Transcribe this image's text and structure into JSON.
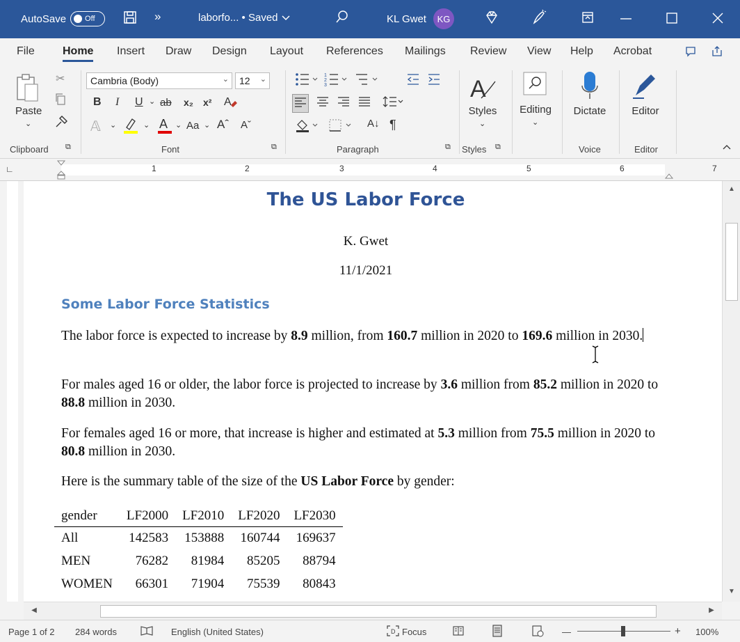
{
  "titlebar": {
    "autosave_label": "AutoSave",
    "autosave_state": "Off",
    "more": "»",
    "doc_name": "laborfo...",
    "saved_status": "• Saved",
    "user_name": "KL Gwet",
    "user_initials": "KG"
  },
  "tabs": [
    "File",
    "Home",
    "Insert",
    "Draw",
    "Design",
    "Layout",
    "References",
    "Mailings",
    "Review",
    "View",
    "Help",
    "Acrobat"
  ],
  "ribbon": {
    "paste_label": "Paste",
    "font_name": "Cambria (Body)",
    "font_size": "12",
    "styles_label": "Styles",
    "editing_label": "Editing",
    "dictate_label": "Dictate",
    "editor_label": "Editor",
    "groups": {
      "clipboard": "Clipboard",
      "font": "Font",
      "paragraph": "Paragraph",
      "styles": "Styles",
      "voice": "Voice",
      "editor": "Editor"
    },
    "bold": "B",
    "italic": "I",
    "underline": "U",
    "strike": "ab",
    "subscript": "x₂",
    "superscript": "x²",
    "change_case": "Aa",
    "grow_font": "Aˆ",
    "shrink_font": "Aˇ",
    "sort": "A↓",
    "pilcrow": "¶"
  },
  "ruler": {
    "numbers": [
      "1",
      "2",
      "3",
      "4",
      "5",
      "6",
      "7"
    ]
  },
  "document": {
    "title": "The US Labor Force",
    "author": "K. Gwet",
    "date": "11/1/2021",
    "heading": "Some Labor Force Statistics",
    "p1": {
      "a": "The labor force is expected to increase by ",
      "b1": "8.9",
      "c": " million, from ",
      "b2": "160.7",
      "d": " million in 2020 to ",
      "b3": "169.6",
      "e": " million in 2030."
    },
    "p2": {
      "a": "For males aged 16 or older, the labor force is projected to increase by ",
      "b1": "3.6",
      "c": " million from ",
      "b2": "85.2",
      "d": " million in 2020 to ",
      "b3": "88.8",
      "e": " million in 2030."
    },
    "p3": {
      "a": "For females aged 16 or more, that increase is higher and estimated at ",
      "b1": "5.3",
      "c": " million from ",
      "b2": "75.5",
      "d": " million in 2020 to ",
      "b3": "80.8",
      "e": " million in 2030."
    },
    "p4": {
      "a": "Here is the summary table of the size of the ",
      "b1": "US Labor Force",
      "c": " by gender:"
    },
    "table": {
      "headers": [
        "gender",
        "LF2000",
        "LF2010",
        "LF2020",
        "LF2030"
      ],
      "rows": [
        [
          "All",
          "142583",
          "153888",
          "160744",
          "169637"
        ],
        [
          "MEN",
          "76282",
          "81984",
          "85205",
          "88794"
        ],
        [
          "WOMEN",
          "66301",
          "71904",
          "75539",
          "80843"
        ]
      ]
    }
  },
  "statusbar": {
    "page": "Page 1 of 2",
    "words": "284 words",
    "language": "English (United States)",
    "focus": "Focus",
    "zoom": "100%",
    "zoom_minus": "—",
    "zoom_plus": "+"
  },
  "colors": {
    "brand": "#2b579a",
    "title": "#2f5496",
    "heading": "#4f81bd"
  }
}
